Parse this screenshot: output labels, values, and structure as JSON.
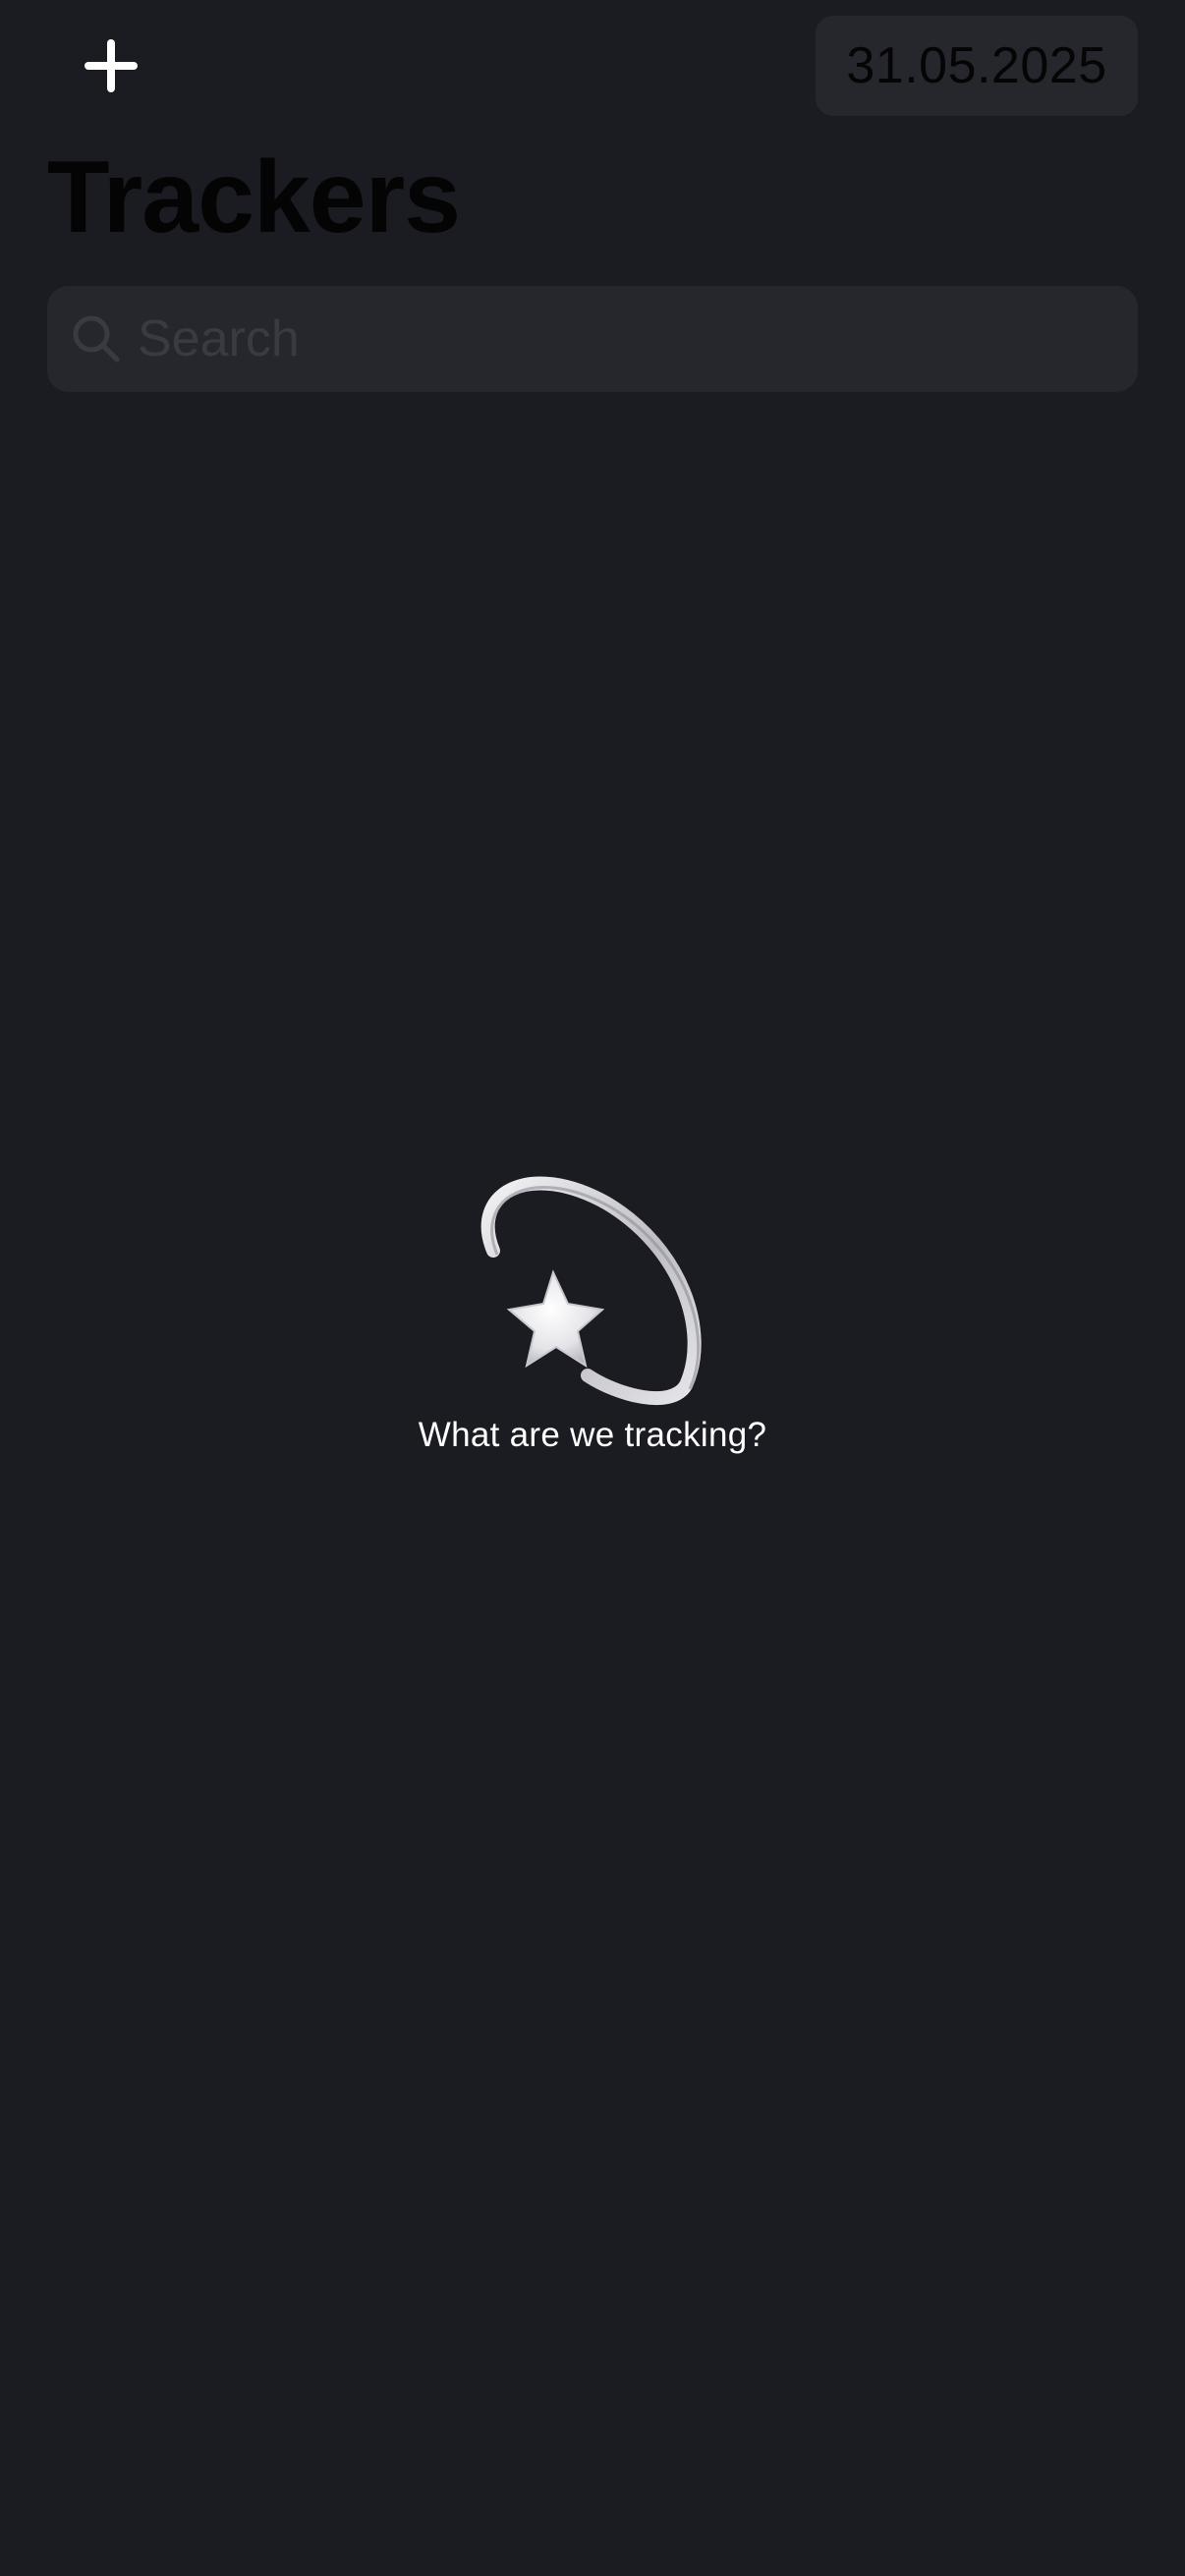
{
  "header": {
    "add_icon": "plus-icon",
    "date": "31.05.2025"
  },
  "page": {
    "title": "Trackers"
  },
  "search": {
    "icon": "search-icon",
    "placeholder": "Search",
    "value": ""
  },
  "empty_state": {
    "icon": "dizzy-star-icon",
    "message": "What are we tracking?"
  },
  "colors": {
    "background": "#1b1b22",
    "surface": "#26262d",
    "text_primary": "#ffffff",
    "text_dark": "#050505",
    "placeholder": "#3a3a42"
  }
}
